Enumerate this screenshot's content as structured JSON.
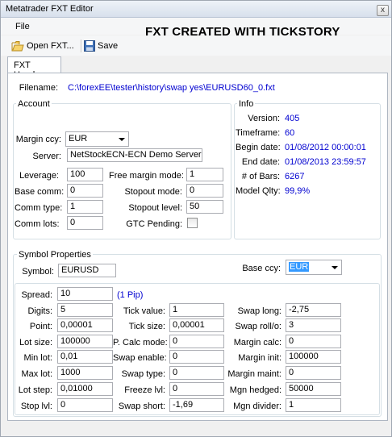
{
  "window": {
    "title": "Metatrader FXT Editor",
    "close_glyph": "x"
  },
  "menu": {
    "file": "File"
  },
  "banner": "FXT CREATED WITH TICKSTORY",
  "toolbar": {
    "open_label": "Open FXT...",
    "save_label": "Save",
    "open_icon": "folder-open-icon",
    "save_icon": "floppy-disk-icon"
  },
  "tab": {
    "label": "FXT Header"
  },
  "filename": {
    "label": "Filename:",
    "value": "C:\\forexEE\\tester\\history\\swap yes\\EURUSD60_0.fxt"
  },
  "account": {
    "title": "Account",
    "margin_ccy_label": "Margin ccy:",
    "margin_ccy": "EUR",
    "server_label": "Server:",
    "server": "NetStockECN-ECN Demo Server",
    "leverage_label": "Leverage:",
    "leverage": "100",
    "base_comm_label": "Base comm:",
    "base_comm": "0",
    "comm_type_label": "Comm type:",
    "comm_type": "1",
    "comm_lots_label": "Comm lots:",
    "comm_lots": "0",
    "free_margin_mode_label": "Free margin mode:",
    "free_margin_mode": "1",
    "stopout_mode_label": "Stopout mode:",
    "stopout_mode": "0",
    "stopout_level_label": "Stopout level:",
    "stopout_level": "50",
    "gtc_pending_label": "GTC Pending:",
    "gtc_pending": false
  },
  "info": {
    "title": "Info",
    "version_label": "Version:",
    "version": "405",
    "timeframe_label": "Timeframe:",
    "timeframe": "60",
    "begin_date_label": "Begin date:",
    "begin_date": "01/08/2012 00:00:01",
    "end_date_label": "End date:",
    "end_date": "01/08/2013 23:59:57",
    "bars_label": "# of Bars:",
    "bars": "6267",
    "model_qlty_label": "Model Qlty:",
    "model_qlty": "99,9%"
  },
  "symbol": {
    "title": "Symbol Properties",
    "symbol_label": "Symbol:",
    "symbol": "EURUSD",
    "base_ccy_label": "Base ccy:",
    "base_ccy": "EUR",
    "spread_label": "Spread:",
    "spread": "10",
    "spread_note": "(1 Pip)",
    "digits_label": "Digits:",
    "digits": "5",
    "point_label": "Point:",
    "point": "0,00001",
    "lot_size_label": "Lot size:",
    "lot_size": "100000",
    "min_lot_label": "Min lot:",
    "min_lot": "0,01",
    "max_lot_label": "Max lot:",
    "max_lot": "1000",
    "lot_step_label": "Lot step:",
    "lot_step": "0,01000",
    "stop_lvl_label": "Stop lvl:",
    "stop_lvl": "0",
    "tick_value_label": "Tick value:",
    "tick_value": "1",
    "tick_size_label": "Tick size:",
    "tick_size": "0,00001",
    "p_calc_mode_label": "P. Calc mode:",
    "p_calc_mode": "0",
    "swap_enable_label": "Swap enable:",
    "swap_enable": "0",
    "swap_type_label": "Swap type:",
    "swap_type": "0",
    "freeze_lvl_label": "Freeze lvl:",
    "freeze_lvl": "0",
    "swap_short_label": "Swap short:",
    "swap_short": "-1,69",
    "swap_long_label": "Swap long:",
    "swap_long": "-2,75",
    "swap_roll_label": "Swap roll/o:",
    "swap_roll": "3",
    "margin_calc_label": "Margin calc:",
    "margin_calc": "0",
    "margin_init_label": "Margin init:",
    "margin_init": "100000",
    "margin_maint_label": "Margin maint:",
    "margin_maint": "0",
    "mgn_hedged_label": "Mgn hedged:",
    "mgn_hedged": "50000",
    "mgn_divider_label": "Mgn divider:",
    "mgn_divider": "1"
  },
  "colors": {
    "value_blue": "#0000d0",
    "selection": "#3399ff"
  }
}
